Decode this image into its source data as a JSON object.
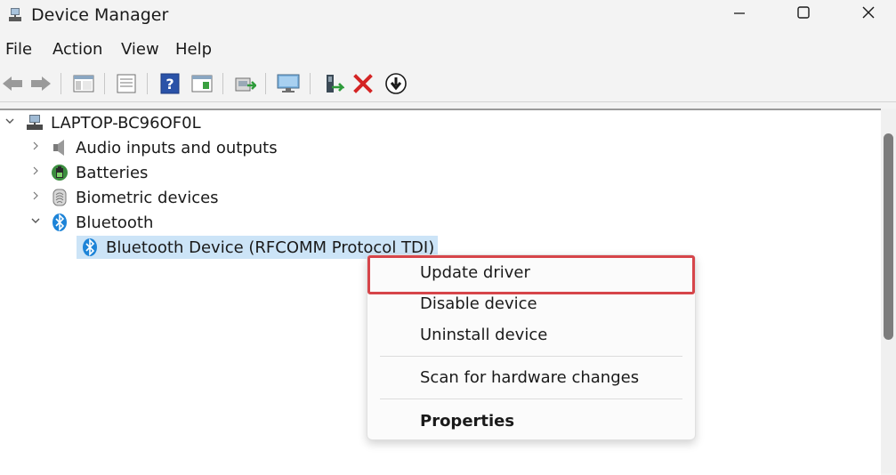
{
  "window": {
    "title": "Device Manager"
  },
  "menu": [
    "File",
    "Action",
    "View",
    "Help"
  ],
  "toolbar": {
    "icons": [
      "back-arrow-icon",
      "forward-arrow-icon",
      "show-hide-console-tree-icon",
      "properties-sheet-icon",
      "help-icon",
      "console-pane-icon",
      "update-driver-software-icon",
      "scan-hardware-icon",
      "enable-device-icon",
      "uninstall-icon",
      "disable-device-icon"
    ]
  },
  "tree": {
    "root": "LAPTOP-BC96OF0L",
    "categories": [
      {
        "label": "Audio inputs and outputs",
        "expanded": false,
        "icon": "speaker-icon"
      },
      {
        "label": "Batteries",
        "expanded": false,
        "icon": "battery-icon"
      },
      {
        "label": "Biometric devices",
        "expanded": false,
        "icon": "fingerprint-icon"
      },
      {
        "label": "Bluetooth",
        "expanded": true,
        "icon": "bluetooth-icon"
      }
    ],
    "selected_child": "Bluetooth Device (RFCOMM Protocol TDI)"
  },
  "context_menu": {
    "items": [
      "Update driver",
      "Disable device",
      "Uninstall device",
      "Scan for hardware changes",
      "Properties"
    ],
    "highlighted": "Update driver",
    "colors": {
      "highlight_border": "#d6454a"
    }
  },
  "colors": {
    "selection": "#cce4f7",
    "bluetooth_blue": "#1d84d8",
    "delete_red": "#d42424"
  }
}
